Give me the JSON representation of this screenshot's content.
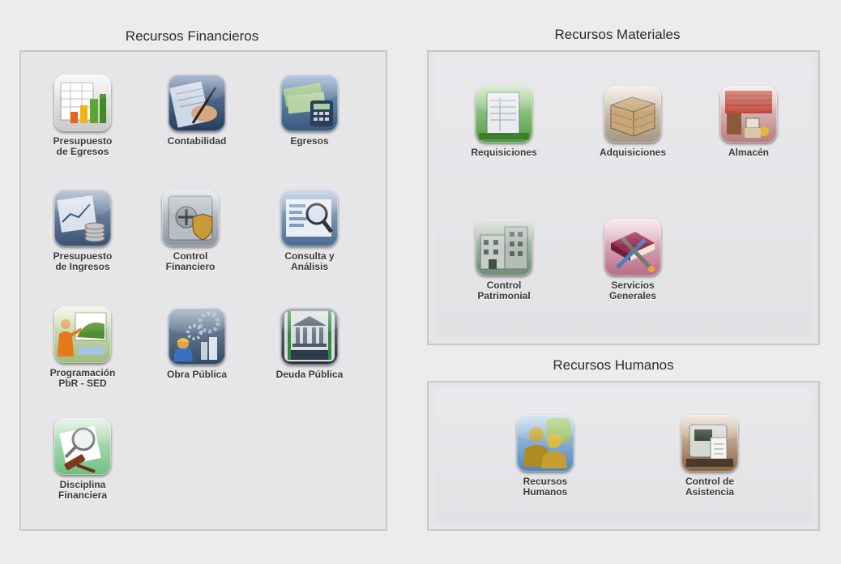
{
  "financieros": {
    "title": "Recursos Financieros",
    "modules": [
      {
        "label": "Presupuesto\nde Egresos",
        "icon": "budget-chart-icon"
      },
      {
        "label": "Contabilidad",
        "icon": "accounting-pen-icon"
      },
      {
        "label": "Egresos",
        "icon": "cash-calculator-icon"
      },
      {
        "label": "Presupuesto\nde Ingresos",
        "icon": "income-coins-icon"
      },
      {
        "label": "Control\nFinanciero",
        "icon": "vault-shield-icon"
      },
      {
        "label": "Consulta y\nAnálisis",
        "icon": "magnifier-report-icon"
      },
      {
        "label": "Programación\nPbR - SED",
        "icon": "planning-presentation-icon"
      },
      {
        "label": "Obra Pública",
        "icon": "construction-worker-icon"
      },
      {
        "label": "Deuda Pública",
        "icon": "bank-icon"
      },
      {
        "label": "Disciplina\nFinanciera",
        "icon": "gavel-magnifier-icon"
      }
    ]
  },
  "materiales": {
    "title": "Recursos Materiales",
    "modules": [
      {
        "label": "Requisiciones",
        "icon": "requisition-form-icon"
      },
      {
        "label": "Adquisiciones",
        "icon": "crate-icon"
      },
      {
        "label": "Almacén",
        "icon": "warehouse-icon"
      },
      {
        "label": "Control\nPatrimonial",
        "icon": "building-icon"
      },
      {
        "label": "Servicios\nGenerales",
        "icon": "tools-book-icon"
      }
    ]
  },
  "humanos": {
    "title": "Recursos Humanos",
    "modules": [
      {
        "label": "Recursos Humanos",
        "icon": "people-icon"
      },
      {
        "label": "Control de Asistencia",
        "icon": "time-clock-icon"
      }
    ]
  }
}
